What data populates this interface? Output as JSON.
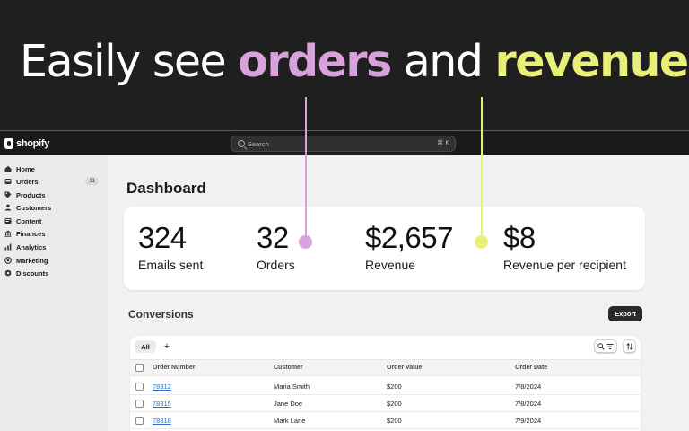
{
  "hero": {
    "part1": "Easily see ",
    "orders_word": "orders",
    "part2": " and ",
    "revenue_word": "revenue",
    "period": "."
  },
  "colors": {
    "orders_accent": "#d9a2dc",
    "revenue_accent": "#e9f07a",
    "link": "#2c6ecb"
  },
  "topbar": {
    "logo_text": "shopify",
    "search_placeholder": "Search",
    "shortcut": "⌘ K"
  },
  "sidebar": {
    "items": [
      {
        "label": "Home",
        "icon": "home-icon"
      },
      {
        "label": "Orders",
        "icon": "orders-icon",
        "badge": "11"
      },
      {
        "label": "Products",
        "icon": "tag-icon"
      },
      {
        "label": "Customers",
        "icon": "person-icon"
      },
      {
        "label": "Content",
        "icon": "content-icon"
      },
      {
        "label": "Finances",
        "icon": "bank-icon"
      },
      {
        "label": "Analytics",
        "icon": "bar-chart-icon"
      },
      {
        "label": "Marketing",
        "icon": "target-icon"
      },
      {
        "label": "Discounts",
        "icon": "gear-icon"
      }
    ]
  },
  "main": {
    "title": "Dashboard",
    "metrics": [
      {
        "value": "324",
        "label": "Emails sent"
      },
      {
        "value": "32",
        "label": "Orders"
      },
      {
        "value": "$2,657",
        "label": "Revenue"
      },
      {
        "value": "$8",
        "label": "Revenue per recipient"
      }
    ],
    "conversions": {
      "title": "Conversions",
      "export_label": "Export",
      "tab_all": "All",
      "tab_add": "+",
      "columns": [
        "Order Number",
        "Customer",
        "Order Value",
        "Order Date"
      ],
      "rows": [
        {
          "order": "78312",
          "customer": "Maria Smith",
          "value": "$200",
          "date": "7/8/2024"
        },
        {
          "order": "78315",
          "customer": "Jane Doe",
          "value": "$200",
          "date": "7/8/2024"
        },
        {
          "order": "78318",
          "customer": "Mark Lane",
          "value": "$200",
          "date": "7/9/2024"
        }
      ]
    }
  }
}
